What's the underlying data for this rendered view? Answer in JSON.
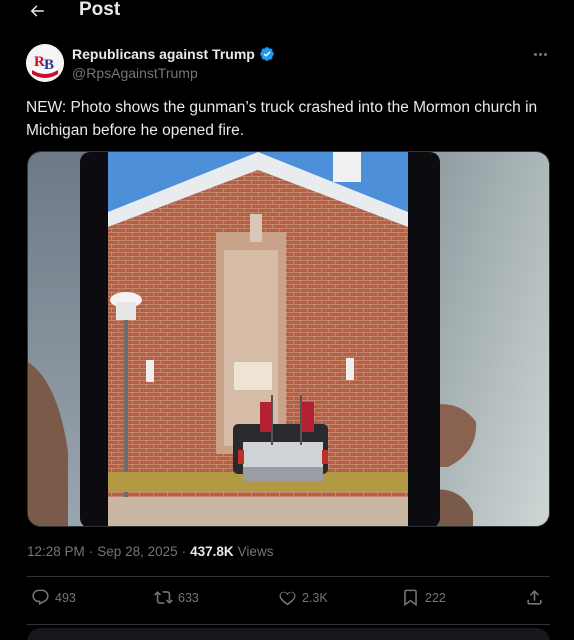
{
  "header": {
    "title": "Post"
  },
  "author": {
    "name": "Republicans against Trump",
    "handle": "@RpsAgainstTrump",
    "avatar_text": "RB"
  },
  "post": {
    "text": "NEW: Photo shows the gunman’s truck crashed into the Mormon church in Michigan before he opened fire."
  },
  "meta": {
    "time": "12:28 PM",
    "sep1": "·",
    "date": "Sep 28, 2025",
    "sep2": "·",
    "views_count": "437.8K",
    "views_label": "Views"
  },
  "actions": {
    "replies": "493",
    "reposts": "633",
    "likes": "2.3K",
    "bookmarks": "222"
  },
  "colors": {
    "background": "#000000",
    "text": "#e7e9ea",
    "muted": "#71767b",
    "accent": "#1d9bf0",
    "border": "#2f3336"
  },
  "icons": [
    "back-arrow-icon",
    "verified-badge-icon",
    "more-icon",
    "reply-icon",
    "repost-icon",
    "like-icon",
    "bookmark-icon",
    "share-icon"
  ]
}
